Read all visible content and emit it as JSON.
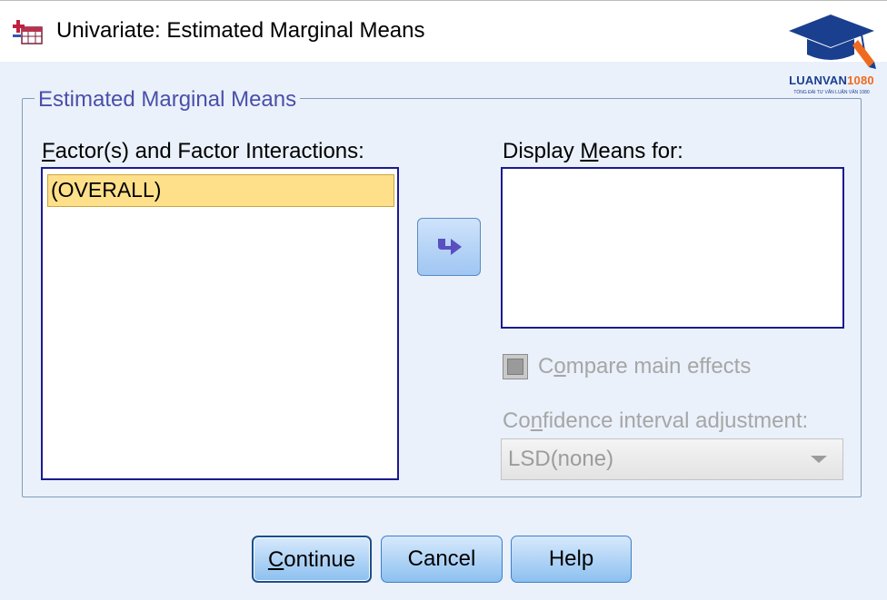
{
  "window": {
    "title": "Univariate: Estimated Marginal Means"
  },
  "logo": {
    "brand_part1": "LUANVAN",
    "brand_part2": "1080",
    "tagline": "TỔNG ĐÀI TƯ VẤN LUẬN VĂN 1080",
    "accent_colors": [
      "#1a3f8f",
      "#ef6a1f"
    ]
  },
  "group": {
    "legend": "Estimated Marginal Means"
  },
  "factors": {
    "label_mnemonic": "F",
    "label_rest": "actor(s) and Factor Interactions:",
    "items": [
      "(OVERALL)"
    ],
    "selected_index": 0
  },
  "move_button": {
    "icon": "right-arrow-icon"
  },
  "display_means": {
    "label_prefix": "Display ",
    "label_mnemonic": "M",
    "label_rest": "eans for:",
    "items": []
  },
  "compare": {
    "label_prefix": "C",
    "label_mnemonic": "o",
    "label_rest": "mpare main effects",
    "checked": false,
    "enabled": false
  },
  "ci_adjustment": {
    "label_prefix": "Co",
    "label_mnemonic": "n",
    "label_rest": "fidence interval adjustment:",
    "selected": "LSD(none)",
    "enabled": false
  },
  "buttons": {
    "continue_mnemonic": "C",
    "continue_rest": "ontinue",
    "cancel": "Cancel",
    "help": "Help"
  },
  "colors": {
    "dialog_bg": "#eaf1fb",
    "selection_bg": "#ffe08a",
    "listbox_border": "#1b1b8f",
    "group_legend": "#4a4fa8"
  }
}
